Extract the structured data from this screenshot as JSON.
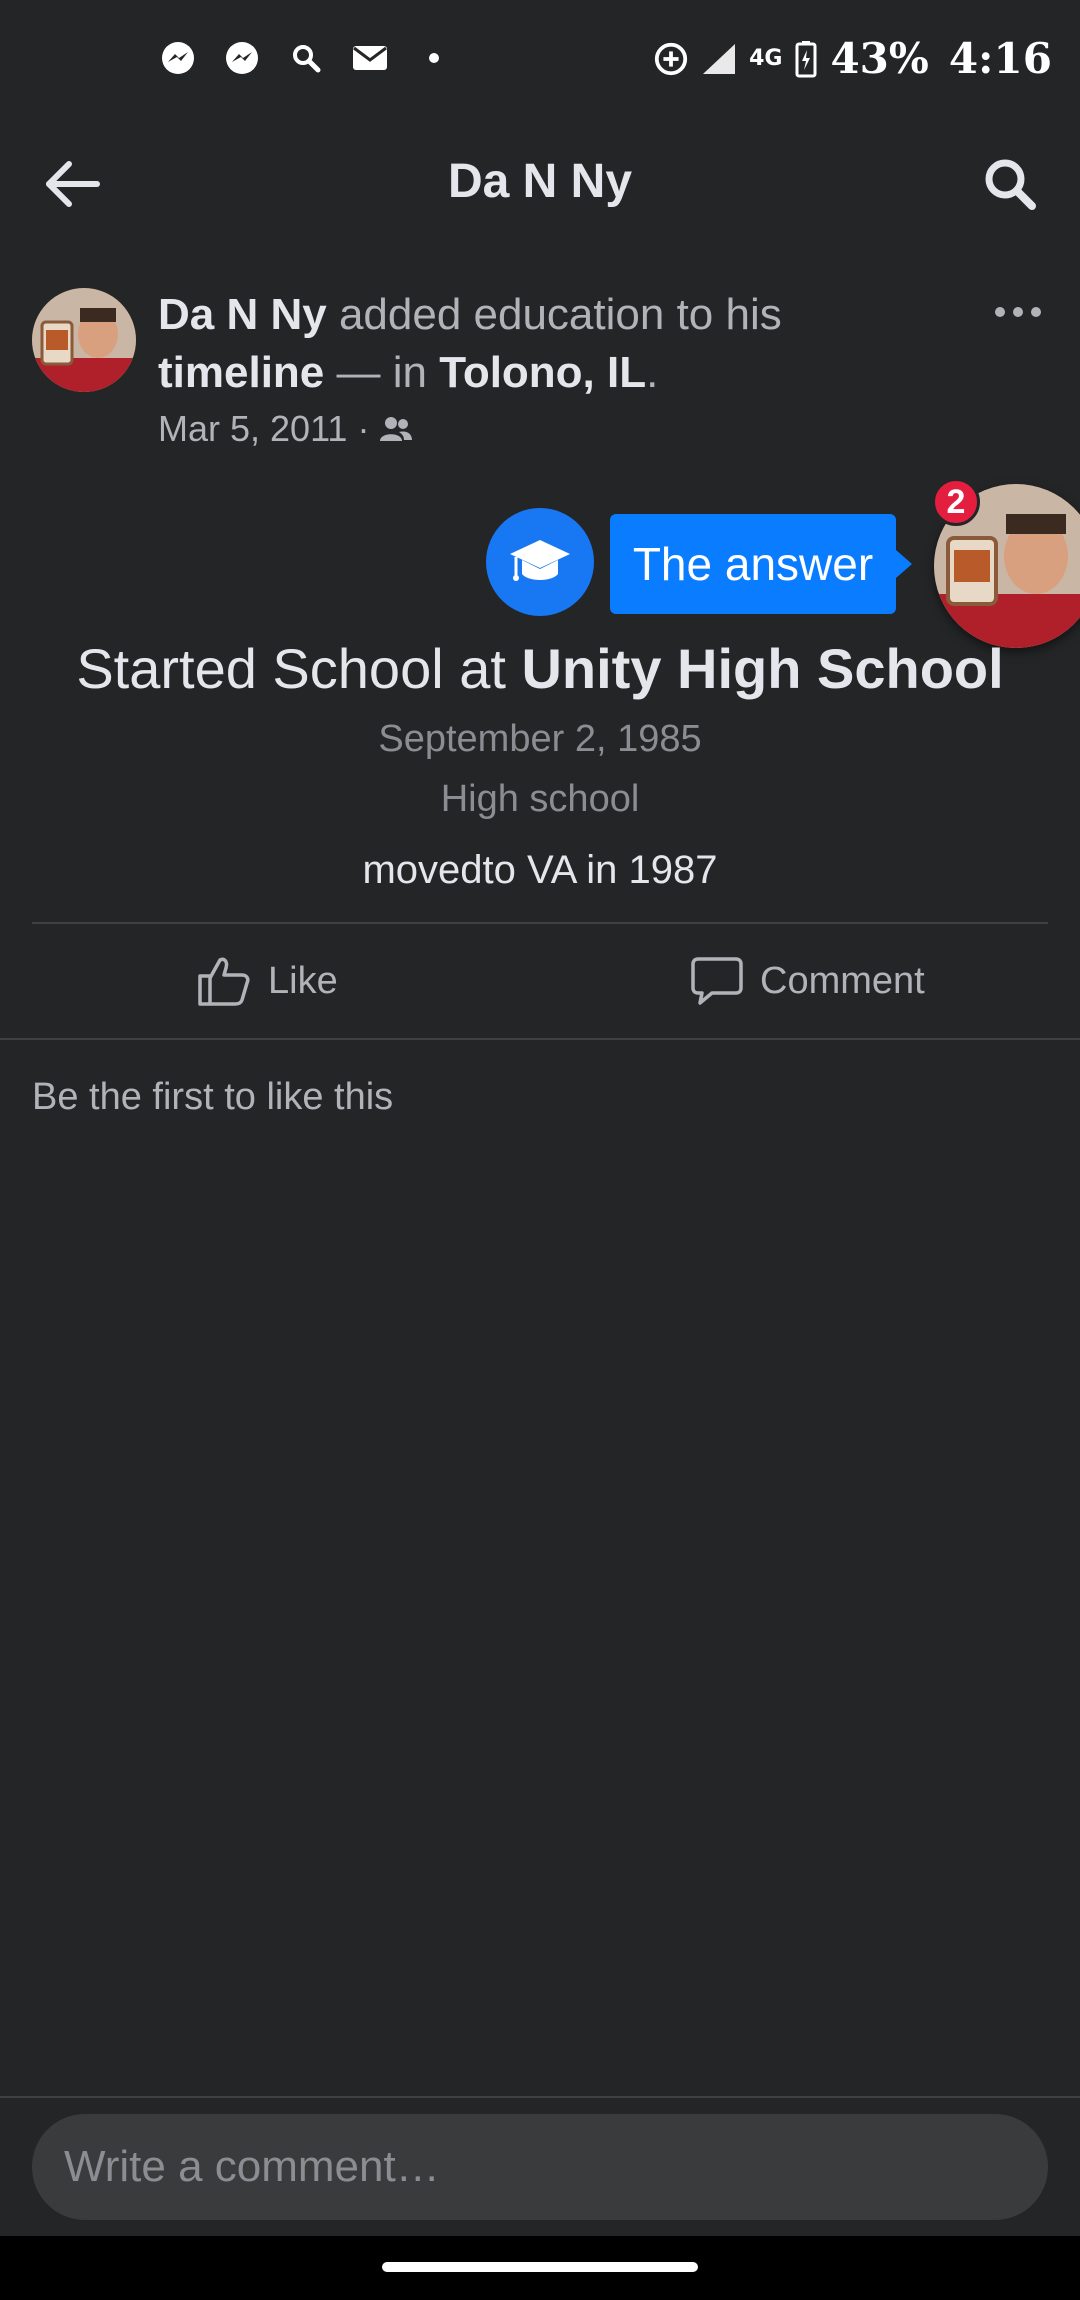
{
  "status_bar": {
    "left_icons": [
      "messenger-icon",
      "messenger-icon",
      "search-icon",
      "mail-icon",
      "dot-icon"
    ],
    "network": "4G",
    "battery": "43%",
    "time": "4:16"
  },
  "topnav": {
    "title": "Da N Ny"
  },
  "post": {
    "author": "Da N Ny",
    "action": " added education to his ",
    "target": "timeline",
    "separator": " — in ",
    "location": "Tolono, IL",
    "end": ".",
    "date": "Mar 5, 2011 ·",
    "privacy_icon": "friends-icon"
  },
  "chat": {
    "bubble": "The answer",
    "badge": "2"
  },
  "event": {
    "title_prefix": "Started School at ",
    "school": "Unity High School",
    "date": "September 2, 1985",
    "type": "High school",
    "description": "movedto VA in 1987"
  },
  "actions": {
    "like": "Like",
    "comment": "Comment"
  },
  "reactions": {
    "text": "Be the first to like this"
  },
  "composer": {
    "placeholder": "Write a comment…"
  },
  "colors": {
    "background": "#242527",
    "accent": "#1877f2",
    "bubble": "#0a7cff",
    "badge": "#e41e3f"
  }
}
